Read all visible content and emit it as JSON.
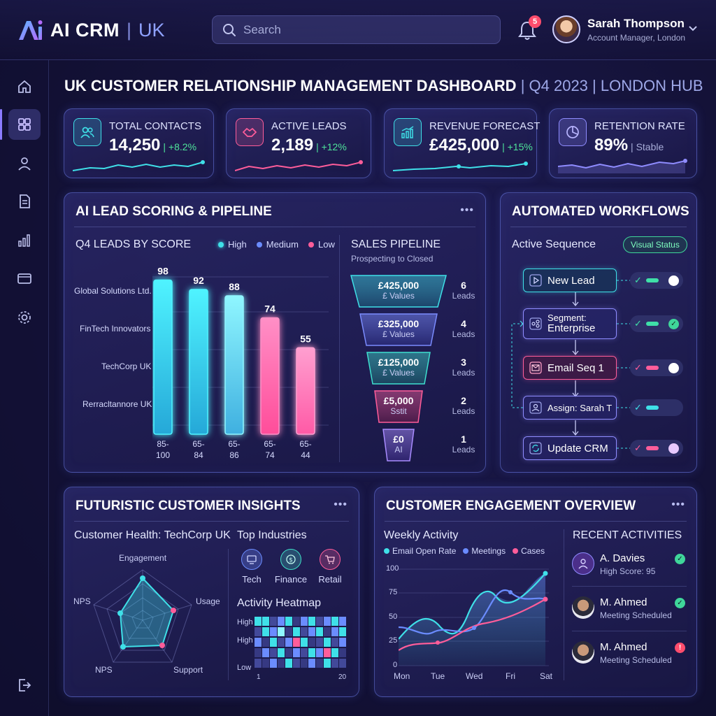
{
  "app": {
    "logo_mark": "Ai",
    "name": "AI CRM",
    "separator": "|",
    "region": "UK"
  },
  "search": {
    "placeholder": "Search"
  },
  "notifications": {
    "count": "5"
  },
  "user": {
    "name": "Sarah Thompson",
    "role": "Account Manager, London"
  },
  "sidebar": {
    "items": [
      {
        "icon": "home-icon"
      },
      {
        "icon": "dashboard-icon",
        "active": true
      },
      {
        "icon": "contacts-icon"
      },
      {
        "icon": "documents-icon"
      },
      {
        "icon": "analytics-icon"
      },
      {
        "icon": "wallet-icon"
      },
      {
        "icon": "settings-icon"
      },
      {
        "icon": "logout-icon"
      }
    ]
  },
  "page": {
    "title": "UK CUSTOMER RELATIONSHIP MANAGEMENT DASHBOARD",
    "subtitle": " | Q4 2023 | LONDON HUB"
  },
  "kpis": [
    {
      "label": "TOTAL CONTACTS",
      "value": "14,250",
      "delta": "| +8.2%",
      "icon": "users-icon",
      "color": "#3fe0e8"
    },
    {
      "label": "ACTIVE LEADS",
      "value": "2,189",
      "delta": "| +12%",
      "icon": "handshake-icon",
      "color": "#ff5d9a"
    },
    {
      "label": "REVENUE FORECAST",
      "value": "£425,000",
      "delta": "| +15%",
      "icon": "trend-chart-icon",
      "color": "#3fe0e8"
    },
    {
      "label": "RETENTION RATE",
      "value": "89%",
      "delta": "| Stable",
      "icon": "pie-icon",
      "color": "#8f8cff"
    }
  ],
  "lead_scoring": {
    "title": "AI LEAD SCORING & PIPELINE",
    "more": "•••",
    "chart_title": "Q4 LEADS BY SCORE",
    "legend": [
      {
        "name": "High",
        "color": "#3fe0e8"
      },
      {
        "name": "Medium",
        "color": "#6b8cff"
      },
      {
        "name": "Low",
        "color": "#ff5d9a"
      }
    ],
    "companies": [
      "Global Solutions Ltd.",
      "FinTech Innovators",
      "TechCorp UK",
      "Rerracltannore UK"
    ]
  },
  "chart_data": {
    "type": "bar",
    "title": "Q4 LEADS BY SCORE",
    "categories": [
      "85-100",
      "65-84",
      "65-86",
      "65-74",
      "65-44"
    ],
    "category_lines": [
      [
        "85-",
        "100"
      ],
      [
        "65-",
        "84"
      ],
      [
        "65-",
        "86"
      ],
      [
        "65-",
        "74"
      ],
      [
        "65-",
        "44"
      ]
    ],
    "values": [
      98,
      92,
      88,
      74,
      55
    ],
    "value_labels": [
      "98",
      "92",
      "88",
      "74",
      "55"
    ],
    "bar_colors": [
      [
        "#4ff3ff",
        "#25a8d8"
      ],
      [
        "#4ff3ff",
        "#25a8d8"
      ],
      [
        "#8ff6ff",
        "#3fb0e0"
      ],
      [
        "#ff8fc6",
        "#ff4d9a"
      ],
      [
        "#ff9fd0",
        "#ff5aa6"
      ]
    ],
    "ylim": [
      0,
      100
    ],
    "grid": true
  },
  "pipeline": {
    "title": "SALES PIPELINE",
    "caption": "Prospecting to Closed",
    "stages": [
      {
        "value": "£425,000",
        "sub": "£ Values",
        "count": "6",
        "unit": "Leads",
        "color": "#3fe0e8"
      },
      {
        "value": "£325,000",
        "sub": "£ Values",
        "count": "4",
        "unit": "Leads",
        "color": "#7b8cff"
      },
      {
        "value": "£125,000",
        "sub": "£ Values",
        "count": "3",
        "unit": "Leads",
        "color": "#3fe0d0"
      },
      {
        "value": "£5,000",
        "sub": "Sstit",
        "count": "2",
        "unit": "Leads",
        "color": "#ff5d9a"
      },
      {
        "value": "£0",
        "sub": "AI",
        "count": "1",
        "unit": "Leads",
        "color": "#a98cff"
      }
    ]
  },
  "workflows": {
    "title": "AUTOMATED WORKFLOWS",
    "more": "",
    "sequence_label": "Active Sequence",
    "status": "Visual Status",
    "nodes": [
      {
        "label": "New Lead",
        "icon": "play-icon"
      },
      {
        "label": "Segment:",
        "label2": "Enterprise",
        "icon": "segment-icon"
      },
      {
        "label": "Email Seq 1",
        "icon": "mail-icon"
      },
      {
        "label": "Assign: Sarah T",
        "icon": "user-icon"
      },
      {
        "label": "Update CRM",
        "icon": "refresh-icon"
      }
    ]
  },
  "insights": {
    "title": "FUTURISTIC CUSTOMER INSIGHTS",
    "more": "•••",
    "health_label": "Customer Health: TechCorp UK",
    "radar_axes": [
      "Engagement",
      "Usage",
      "Support",
      "NPS",
      "NPS"
    ],
    "industries_title": "Top Industries",
    "industries": [
      {
        "name": "Tech",
        "icon": "monitor-icon",
        "color": "#6b8cff"
      },
      {
        "name": "Finance",
        "icon": "coin-icon",
        "color": "#3fe0c8"
      },
      {
        "name": "Retail",
        "icon": "cart-icon",
        "color": "#ff5d9a"
      }
    ],
    "heatmap_title": "Activity Heatmap",
    "heatmap_rows": [
      "High",
      "High",
      "",
      "",
      "Low"
    ],
    "heatmap_x_start": "1",
    "heatmap_x_end": "20"
  },
  "engagement": {
    "title": "CUSTOMER ENGAGEMENT OVERVIEW",
    "more": "•••",
    "weekly_title": "Weekly Activity",
    "legend": [
      {
        "name": "Email Open Rate",
        "color": "#3fe0e8"
      },
      {
        "name": "Meetings",
        "color": "#6b8cff"
      },
      {
        "name": "Cases",
        "color": "#ff5d9a"
      }
    ],
    "y_ticks": [
      "100",
      "75",
      "50",
      "25",
      "0"
    ],
    "x_ticks": [
      "Mon",
      "Tue",
      "Wed",
      "Fri",
      "Sat"
    ],
    "recent_title": "RECENT ACTIVITIES",
    "activities": [
      {
        "name": "A. Davies",
        "detail": "High Score: 95",
        "status": "ok"
      },
      {
        "name": "M. Ahmed",
        "detail": "Meeting Scheduled",
        "status": "ok"
      },
      {
        "name": "M. Ahmed",
        "detail": "Meeting Scheduled",
        "status": "alert"
      }
    ]
  }
}
